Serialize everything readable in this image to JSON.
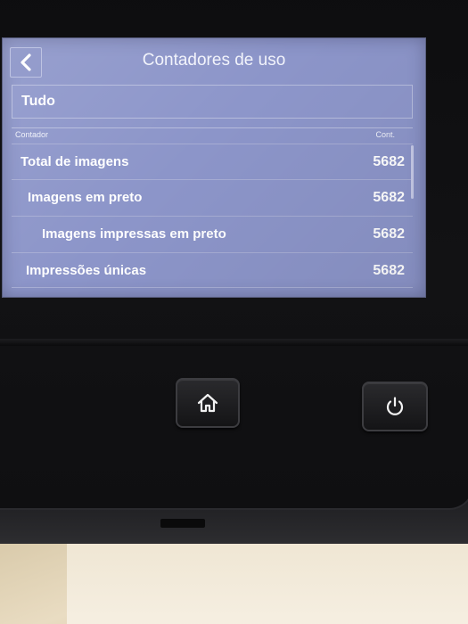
{
  "header": {
    "title": "Contadores de uso",
    "back_icon": "chevron-left-icon"
  },
  "filter": {
    "value": "Tudo"
  },
  "table": {
    "columns": [
      "Contador",
      "Cont."
    ],
    "rows": [
      {
        "label": "Total de imagens",
        "value": "5682"
      },
      {
        "label": "Imagens em preto",
        "value": "5682"
      },
      {
        "label": "Imagens impressas em preto",
        "value": "5682"
      },
      {
        "label": "Impressões únicas",
        "value": "5682"
      }
    ]
  },
  "hardware": {
    "home_icon": "home-icon",
    "power_icon": "power-icon"
  },
  "colors": {
    "screen_bg": "#8c95c9",
    "text": "#ffffff",
    "bezel": "#121214"
  }
}
